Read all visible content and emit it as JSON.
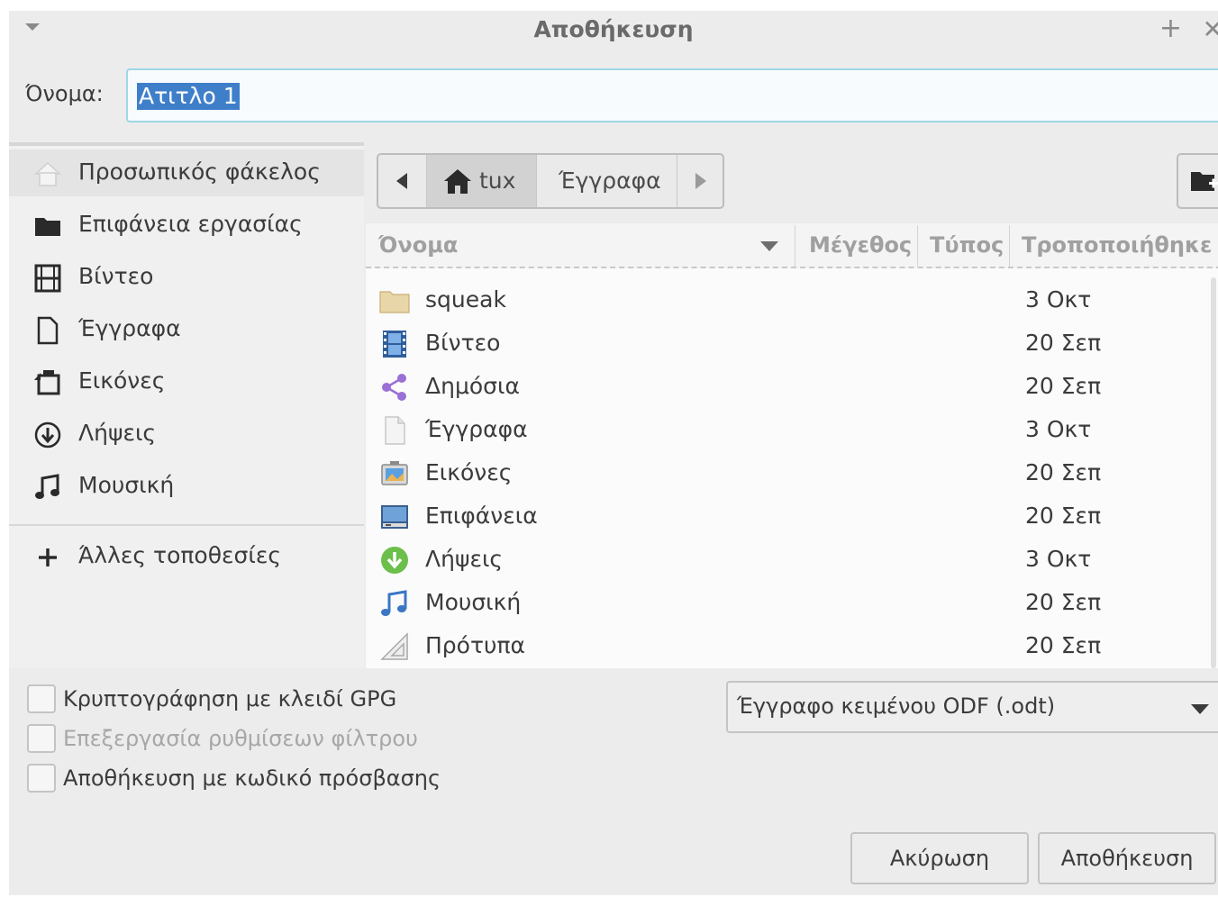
{
  "window": {
    "title": "Αποθήκευση"
  },
  "name_field": {
    "label": "Όνομα:",
    "value": "Ατιτλο 1"
  },
  "sidebar": {
    "items": [
      {
        "label": "Προσωπικός φάκελος",
        "icon": "home-icon",
        "selected": true
      },
      {
        "label": "Επιφάνεια εργασίας",
        "icon": "desktop-folder-icon"
      },
      {
        "label": "Βίντεο",
        "icon": "video-icon"
      },
      {
        "label": "Έγγραφα",
        "icon": "document-icon"
      },
      {
        "label": "Εικόνες",
        "icon": "pictures-icon"
      },
      {
        "label": "Λήψεις",
        "icon": "download-icon"
      },
      {
        "label": "Μουσική",
        "icon": "music-icon"
      }
    ],
    "other_locations": {
      "label": "Άλλες τοποθεσίες",
      "icon": "plus-icon"
    }
  },
  "pathbar": {
    "home": "tux",
    "current": "Έγγραφα"
  },
  "columns": {
    "name": "Όνομα",
    "size": "Μέγεθος",
    "type": "Τύπος",
    "modified": "Τροποποιήθηκε"
  },
  "files": [
    {
      "name": "squeak",
      "modified": "3 Οκτ",
      "icon": "folder-icon"
    },
    {
      "name": "Βίντεο",
      "modified": "20 Σεπ",
      "icon": "video-folder-icon"
    },
    {
      "name": "Δημόσια",
      "modified": "20 Σεπ",
      "icon": "share-icon"
    },
    {
      "name": "Έγγραφα",
      "modified": "3 Οκτ",
      "icon": "document-folder-icon"
    },
    {
      "name": "Εικόνες",
      "modified": "20 Σεπ",
      "icon": "pictures-folder-icon"
    },
    {
      "name": "Επιφάνεια",
      "modified": "20 Σεπ",
      "icon": "desktop-folder-icon"
    },
    {
      "name": "Λήψεις",
      "modified": "3 Οκτ",
      "icon": "download-folder-icon"
    },
    {
      "name": "Μουσική",
      "modified": "20 Σεπ",
      "icon": "music-folder-icon"
    },
    {
      "name": "Πρότυπα",
      "modified": "20 Σεπ",
      "icon": "templates-folder-icon"
    }
  ],
  "options": {
    "gpg": "Κρυπτογράφηση με κλειδί GPG",
    "filter_settings": "Επεξεργασία ρυθμίσεων φίλτρου",
    "password": "Αποθήκευση με κωδικό πρόσβασης"
  },
  "filetype": {
    "selected": "Έγγραφο κειμένου ODF (.odt)"
  },
  "buttons": {
    "cancel": "Ακύρωση",
    "save": "Αποθήκευση"
  },
  "colors": {
    "selection": "#3f7fca",
    "accent": "#9fd6e6",
    "share": "#9a6fd6",
    "download": "#6cbf4a",
    "music": "#3a76c4"
  }
}
